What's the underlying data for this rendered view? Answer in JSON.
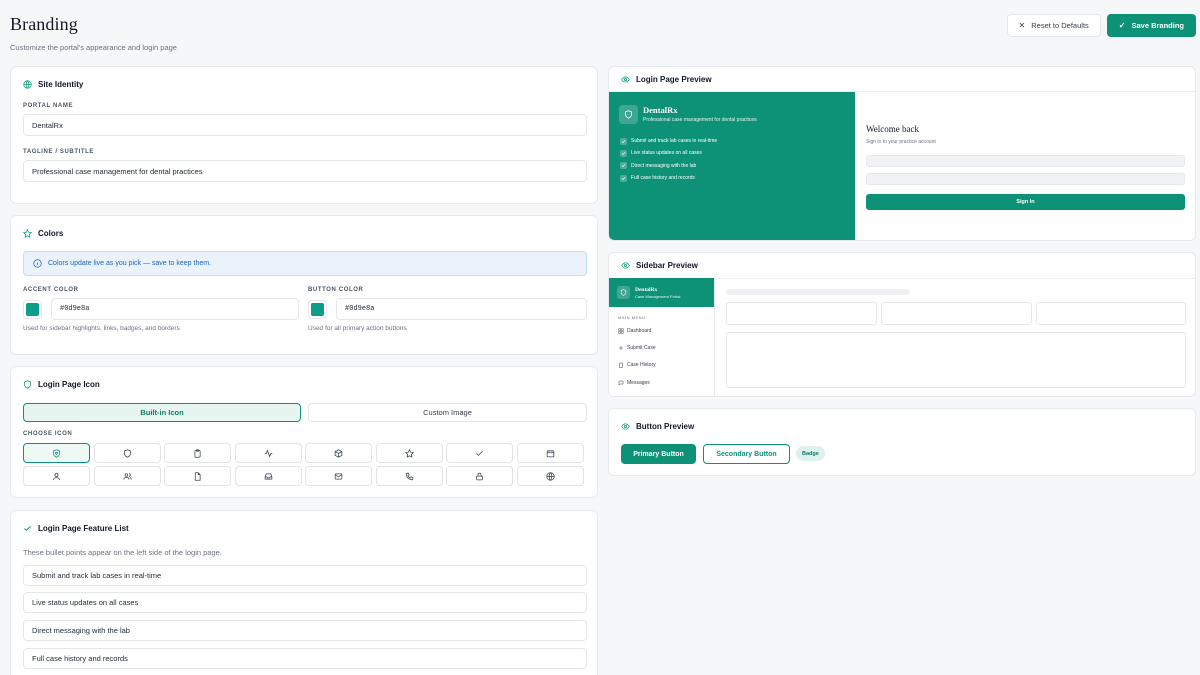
{
  "header": {
    "title": "Branding",
    "subtitle": "Customize the portal's appearance and login page",
    "reset_label": "Reset to Defaults",
    "save_label": "Save Branding"
  },
  "site_identity": {
    "title": "Site Identity",
    "portal_name_label": "PORTAL NAME",
    "portal_name_value": "DentalRx",
    "tagline_label": "TAGLINE / SUBTITLE",
    "tagline_value": "Professional case management for dental practices"
  },
  "colors": {
    "title": "Colors",
    "info": "Colors update live as you pick — save to keep them.",
    "accent_label": "ACCENT COLOR",
    "accent_value": "#0d9e8a",
    "accent_hint": "Used for sidebar highlights, links, badges, and borders",
    "button_label": "BUTTON COLOR",
    "button_value": "#0d9e8a",
    "button_hint": "Used for all primary action buttons",
    "accent_swatch": "#0d9e8a"
  },
  "login_icon": {
    "title": "Login Page Icon",
    "tab_builtin": "Built-in Icon",
    "tab_custom": "Custom Image",
    "choose_label": "CHOOSE ICON",
    "icons": [
      "shield-heart",
      "shield",
      "clipboard",
      "activity",
      "box",
      "star",
      "check",
      "calendar",
      "user",
      "users",
      "file",
      "inbox",
      "mail",
      "phone",
      "lock",
      "globe"
    ],
    "selected": "shield-heart"
  },
  "feature_list": {
    "title": "Login Page Feature List",
    "desc": "These bullet points appear on the left side of the login page.",
    "items": [
      "Submit and track lab cases in real-time",
      "Live status updates on all cases",
      "Direct messaging with the lab",
      "Full case history and records"
    ]
  },
  "login_preview": {
    "title": "Login Page Preview",
    "name": "DentalRx",
    "tagline": "Professional case management for dental practices",
    "features": [
      "Submit and track lab cases in real-time",
      "Live status updates on all cases",
      "Direct messaging with the lab",
      "Full case history and records"
    ],
    "welcome": "Welcome back",
    "signin_sub": "Sign in to your practice account",
    "signin_button": "Sign In"
  },
  "sidebar_preview": {
    "title": "Sidebar Preview",
    "name": "DentalRx",
    "tagline": "Case Management Portal",
    "menu_label": "MAIN MENU",
    "items": [
      "Dashboard",
      "Submit Case",
      "Case History",
      "Messages"
    ]
  },
  "button_preview": {
    "title": "Button Preview",
    "primary": "Primary Button",
    "secondary": "Secondary Button",
    "badge": "Badge"
  }
}
